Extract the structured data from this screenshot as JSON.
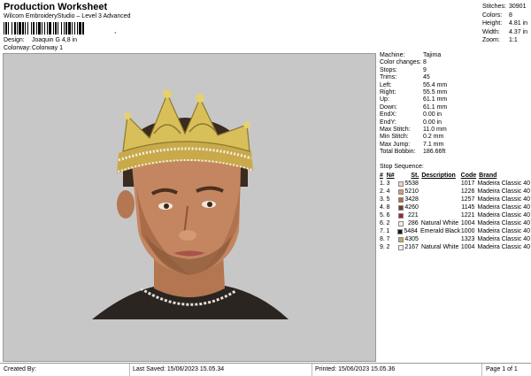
{
  "header": {
    "title": "Production Worksheet",
    "subtitle": "Wilcom EmbroideryStudio – Level 3 Advanced",
    "barcode_suffix": ",",
    "design_label": "Design:",
    "design_value": "Joaquin G 4,8 in",
    "colorway_label": "Colorway:",
    "colorway_value": "Colorway 1"
  },
  "stats_top": [
    {
      "label": "Stitches:",
      "value": "30901"
    },
    {
      "label": "Colors:",
      "value": "8"
    },
    {
      "label": "Height:",
      "value": "4.81 in"
    },
    {
      "label": "Width:",
      "value": "4.37 in"
    },
    {
      "label": "Zoom:",
      "value": "1:1"
    }
  ],
  "info": [
    {
      "label": "Machine:",
      "value": "Tajima"
    },
    {
      "label": "Color changes:",
      "value": "8"
    },
    {
      "label": "Stops:",
      "value": "9"
    },
    {
      "label": "Trims:",
      "value": "45"
    },
    {
      "label": "Left:",
      "value": "55.4 mm"
    },
    {
      "label": "Right:",
      "value": "55.5 mm"
    },
    {
      "label": "Up:",
      "value": "61.1 mm"
    },
    {
      "label": "Down:",
      "value": "61.1 mm"
    },
    {
      "label": "EndX:",
      "value": "0.00 in"
    },
    {
      "label": "EndY:",
      "value": "0.00 in"
    },
    {
      "label": "Max Stitch:",
      "value": "11.0 mm"
    },
    {
      "label": "Min Stitch:",
      "value": "0.2 mm"
    },
    {
      "label": "Max Jump:",
      "value": "7.1 mm"
    },
    {
      "label": "Total Bobbin:",
      "value": "186.66ft"
    }
  ],
  "sequence": {
    "title": "Stop Sequence:",
    "headers": {
      "idx": "#",
      "n": "N#",
      "st": "St.",
      "desc": "Description",
      "code": "Code",
      "brand": "Brand"
    },
    "rows": [
      {
        "idx": "1.",
        "n": "3",
        "color": "#f6cdb8",
        "st": "5538",
        "desc": "",
        "code": "1017",
        "brand": "Madeira Classic 40"
      },
      {
        "idx": "2.",
        "n": "4",
        "color": "#e0986e",
        "st": "5210",
        "desc": "",
        "code": "1226",
        "brand": "Madeira Classic 40"
      },
      {
        "idx": "3.",
        "n": "5",
        "color": "#b86a3e",
        "st": "3428",
        "desc": "",
        "code": "1257",
        "brand": "Madeira Classic 40"
      },
      {
        "idx": "4.",
        "n": "8",
        "color": "#6b4126",
        "st": "4260",
        "desc": "",
        "code": "1145",
        "brand": "Madeira Classic 40"
      },
      {
        "idx": "5.",
        "n": "6",
        "color": "#9a2a26",
        "st": "221",
        "desc": "",
        "code": "1221",
        "brand": "Madeira Classic 40"
      },
      {
        "idx": "6.",
        "n": "2",
        "color": "#f4f0e8",
        "st": "286",
        "desc": "Natural White",
        "code": "1004",
        "brand": "Madeira Classic 40"
      },
      {
        "idx": "7.",
        "n": "1",
        "color": "#1a1a1a",
        "st": "5484",
        "desc": "Emerald Black",
        "code": "1000",
        "brand": "Madeira Classic 40"
      },
      {
        "idx": "8.",
        "n": "7",
        "color": "#c9a94a",
        "st": "4305",
        "desc": "",
        "code": "1323",
        "brand": "Madeira Classic 40"
      },
      {
        "idx": "9.",
        "n": "2",
        "color": "#f4f0e8",
        "st": "2167",
        "desc": "Natural White",
        "code": "1004",
        "brand": "Madeira Classic 40"
      }
    ]
  },
  "footer": {
    "created": "Created By:",
    "saved": "Last Saved: 15/06/2023 15.05.34",
    "printed": "Printed: 15/06/2023 15.05.36",
    "page": "Page 1 of 1"
  }
}
